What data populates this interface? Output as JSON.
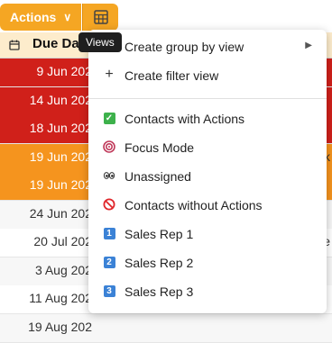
{
  "toolbar": {
    "actions_label": "Actions",
    "views_icon": "grid-icon"
  },
  "tooltip": {
    "text": "Views"
  },
  "column_header": {
    "label": "Due Da",
    "icon": "calendar-icon"
  },
  "rows": [
    {
      "date": "9 Jun 202",
      "bg": "#d0201a",
      "fg": "#ffffff",
      "rhs": ""
    },
    {
      "date": "14 Jun 202",
      "bg": "#d0201a",
      "fg": "#ffffff",
      "rhs": ""
    },
    {
      "date": "18 Jun 202",
      "bg": "#d0201a",
      "fg": "#ffffff",
      "rhs": ""
    },
    {
      "date": "19 Jun 202",
      "bg": "#f5941e",
      "fg": "#ffffff",
      "rhs": "k"
    },
    {
      "date": "19 Jun 202",
      "bg": "#f5941e",
      "fg": "#ffffff",
      "rhs": ""
    },
    {
      "date": "24 Jun 202",
      "bg": "#f7f7f7",
      "fg": "#333333",
      "rhs": ""
    },
    {
      "date": "20 Jul 202",
      "bg": "#ffffff",
      "fg": "#333333",
      "rhs": "e"
    },
    {
      "date": "3 Aug 202",
      "bg": "#f7f7f7",
      "fg": "#333333",
      "rhs": ""
    },
    {
      "date": "11 Aug 202",
      "bg": "#ffffff",
      "fg": "#333333",
      "rhs": ""
    },
    {
      "date": "19 Aug 202",
      "bg": "#f7f7f7",
      "fg": "#333333",
      "rhs": ""
    }
  ],
  "menu": {
    "create_group": "Create group by view",
    "create_filter": "Create filter view",
    "views": [
      {
        "label": "Contacts with Actions",
        "icon": "check-box-icon",
        "color": "#3db14b",
        "glyph": "✓"
      },
      {
        "label": "Focus Mode",
        "icon": "target-icon",
        "color": "#c0395a",
        "glyph": ""
      },
      {
        "label": "Unassigned",
        "icon": "eyes-icon",
        "color": "#333333",
        "glyph": ""
      },
      {
        "label": "Contacts without Actions",
        "icon": "prohibited-icon",
        "color": "#e0262b",
        "glyph": ""
      },
      {
        "label": "Sales Rep 1",
        "icon": "number-one-icon",
        "color": "#3b82d6",
        "glyph": "1"
      },
      {
        "label": "Sales Rep 2",
        "icon": "number-two-icon",
        "color": "#3b82d6",
        "glyph": "2"
      },
      {
        "label": "Sales Rep 3",
        "icon": "number-three-icon",
        "color": "#3b82d6",
        "glyph": "3"
      }
    ]
  }
}
